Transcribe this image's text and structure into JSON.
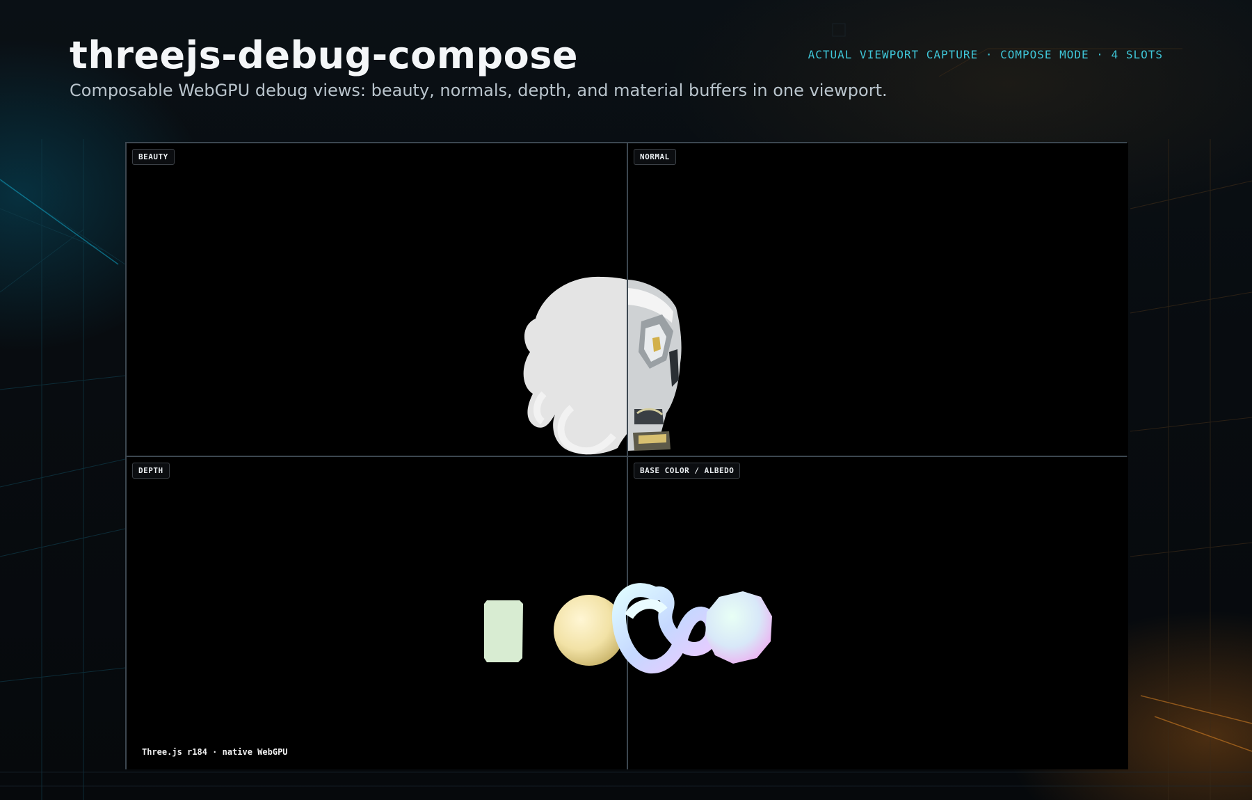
{
  "header": {
    "title": "threejs-debug-compose",
    "subtitle": "Composable WebGPU debug views: beauty, normals, depth, and material buffers in one viewport.",
    "meta": "ACTUAL VIEWPORT CAPTURE · COMPOSE MODE · 4 SLOTS"
  },
  "viewport": {
    "slots": [
      {
        "label": "BEAUTY"
      },
      {
        "label": "NORMAL"
      },
      {
        "label": "DEPTH"
      },
      {
        "label": "BASE COLOR / ALBEDO"
      }
    ],
    "footer": "Three.js r184 · native WebGPU"
  },
  "scene": {
    "objects": [
      {
        "name": "helmet",
        "color": "#e6e6e6"
      },
      {
        "name": "cube",
        "color": "#d8ecd2"
      },
      {
        "name": "sphere",
        "color": "#f2e2a6"
      },
      {
        "name": "torus-knot",
        "color": "#dff2ff"
      },
      {
        "name": "icosphere",
        "color": "#e4f0f8"
      }
    ]
  },
  "colors": {
    "accent": "#3fc7d9",
    "background": "#05080b",
    "panel_border": "#3c4750"
  }
}
